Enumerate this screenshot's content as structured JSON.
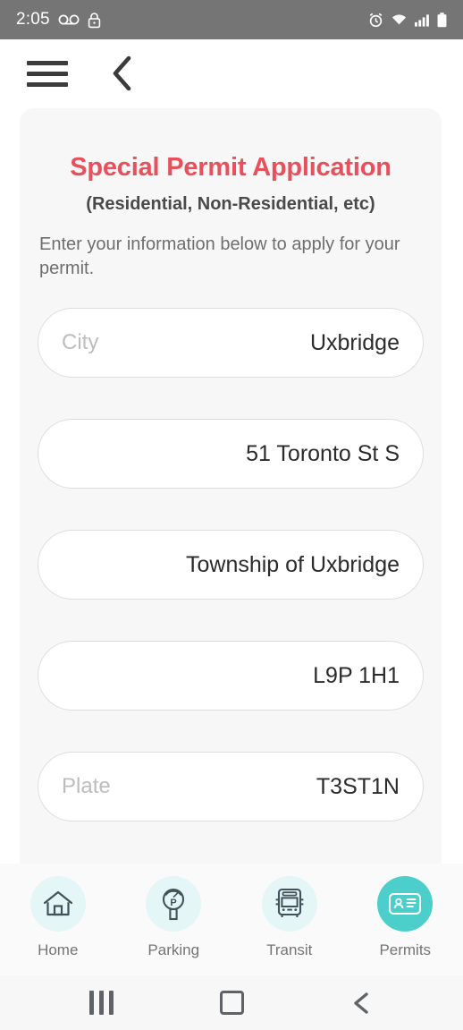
{
  "status_bar": {
    "time": "2:05",
    "left_icons": [
      "voicemail-icon",
      "lock-icon"
    ],
    "right_icons": [
      "alarm-icon",
      "wifi-icon",
      "signal-icon",
      "battery-icon"
    ],
    "background": "#757575"
  },
  "app_header": {
    "menu_icon": "hamburger-menu-icon",
    "back_icon": "back-chevron-icon"
  },
  "card": {
    "title": "Special Permit Application",
    "title_color": "#E8505B",
    "subtitle": "(Residential, Non-Residential, etc)",
    "description": "Enter your information below to apply for your permit.",
    "fields": [
      {
        "name": "city",
        "placeholder": "City",
        "value": "Uxbridge"
      },
      {
        "name": "address",
        "placeholder": "",
        "value": "51 Toronto St S"
      },
      {
        "name": "municipality",
        "placeholder": "",
        "value": "Township of Uxbridge"
      },
      {
        "name": "postal-code",
        "placeholder": "",
        "value": "L9P 1H1"
      },
      {
        "name": "plate",
        "placeholder": "Plate",
        "value": "T3ST1N"
      }
    ]
  },
  "tabbar": {
    "active_color": "#4CCFCB",
    "inactive_circle_color": "#E4F6F6",
    "items": [
      {
        "label": "Home",
        "icon": "home-icon",
        "active": false
      },
      {
        "label": "Parking",
        "icon": "parking-meter-icon",
        "active": false
      },
      {
        "label": "Transit",
        "icon": "bus-icon",
        "active": false
      },
      {
        "label": "Permits",
        "icon": "id-card-icon",
        "active": true
      }
    ]
  },
  "android_nav": {
    "recents": "recents-icon",
    "home": "home-square-icon",
    "back": "back-icon"
  }
}
